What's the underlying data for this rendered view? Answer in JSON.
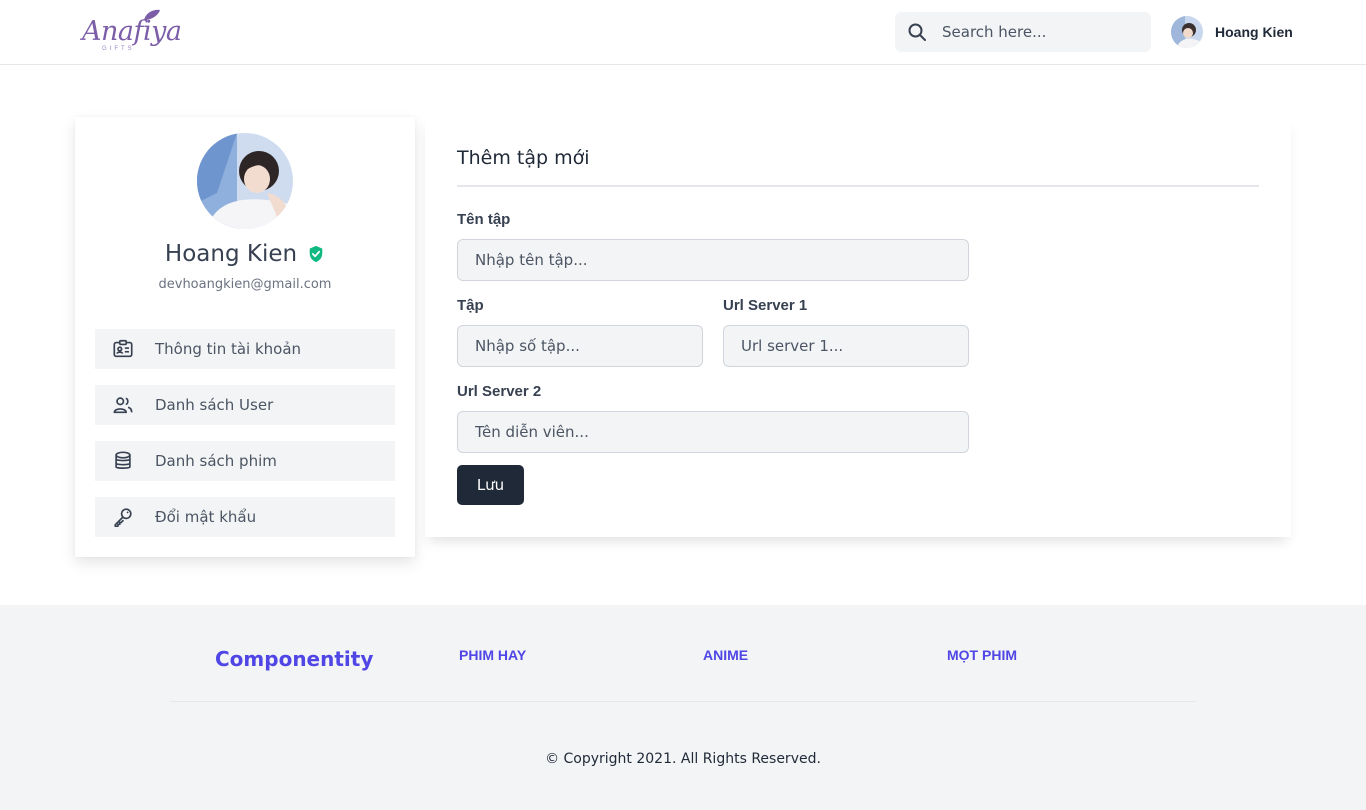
{
  "header": {
    "logo_text": "Anafiya",
    "logo_sub": "GIFTS",
    "search_placeholder": "Search here...",
    "user_name": "Hoang Kien"
  },
  "profile": {
    "name": "Hoang Kien",
    "email": "devhoangkien@gmail.com",
    "menu": [
      {
        "label": "Thông tin tài khoản",
        "icon": "id-card-icon"
      },
      {
        "label": "Danh sách User",
        "icon": "users-icon"
      },
      {
        "label": "Danh sách phim",
        "icon": "database-icon"
      },
      {
        "label": "Đổi mật khẩu",
        "icon": "key-icon"
      }
    ]
  },
  "form": {
    "title": "Thêm tập mới",
    "fields": {
      "episode_name": {
        "label": "Tên tập",
        "placeholder": "Nhập tên tập..."
      },
      "episode_number": {
        "label": "Tập",
        "placeholder": "Nhập số tập..."
      },
      "url_server_1": {
        "label": "Url Server 1",
        "placeholder": "Url server 1..."
      },
      "url_server_2": {
        "label": "Url Server 2",
        "placeholder": "Tên diễn viên..."
      }
    },
    "save_label": "Lưu"
  },
  "footer": {
    "brand": "Componentity",
    "links": [
      "PHIM HAY",
      "ANIME",
      "MỌT PHIM"
    ],
    "copyright": "© Copyright 2021. All Rights Reserved."
  },
  "colors": {
    "accent": "#4f46e5",
    "button": "#1f2937",
    "verified": "#10b981",
    "logo": "#7b5ea7"
  }
}
